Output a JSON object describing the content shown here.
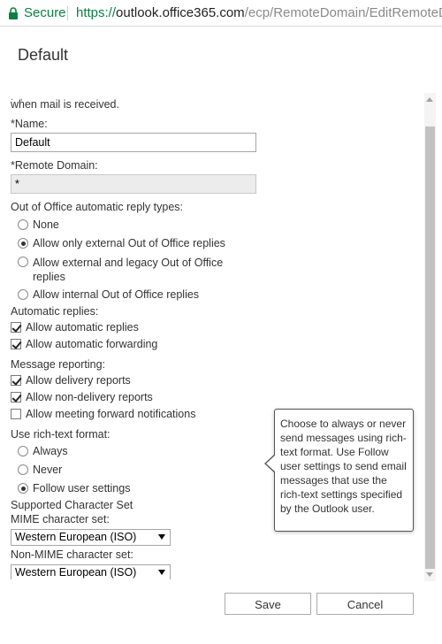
{
  "browser": {
    "secure_label": "Secure",
    "url_protocol": "https://",
    "url_host": "outlook.office365.com",
    "url_path": "/ecp/RemoteDomain/EditRemoteD..."
  },
  "dialog": {
    "title": "Default"
  },
  "form": {
    "clipped_text": "when mail is received.",
    "name_label": "*Name:",
    "name_value": "Default",
    "remote_domain_label": "*Remote Domain:",
    "remote_domain_value": "*",
    "ooo_label": "Out of Office automatic reply types:",
    "ooo_options": [
      {
        "label": "None",
        "selected": false
      },
      {
        "label": "Allow only external Out of Office replies",
        "selected": true
      },
      {
        "label": "Allow external and legacy Out of Office replies",
        "selected": false
      },
      {
        "label": "Allow internal Out of Office replies",
        "selected": false
      }
    ],
    "auto_label": "Automatic replies:",
    "auto_options": [
      {
        "label": "Allow automatic replies",
        "checked": true
      },
      {
        "label": "Allow automatic forwarding",
        "checked": true
      }
    ],
    "report_label": "Message reporting:",
    "report_options": [
      {
        "label": "Allow delivery reports",
        "checked": true
      },
      {
        "label": "Allow non-delivery reports",
        "checked": true
      },
      {
        "label": "Allow meeting forward notifications",
        "checked": false
      }
    ],
    "richtext_label": "Use rich-text format:",
    "richtext_options": [
      {
        "label": "Always",
        "selected": false
      },
      {
        "label": "Never",
        "selected": false
      },
      {
        "label": "Follow user settings",
        "selected": true
      }
    ],
    "charset_label": "Supported Character Set",
    "mime_label": "MIME character set:",
    "mime_value": "Western European (ISO)",
    "nonmime_label": "Non-MIME character set:",
    "nonmime_value": "Western European (ISO)"
  },
  "tooltip": {
    "text": "Choose to always or never send messages using rich-text format. Use Follow user settings to send email messages that use the rich-text settings specified by the Outlook user."
  },
  "buttons": {
    "save": "Save",
    "cancel": "Cancel"
  },
  "colors": {
    "secure_green": "#0b8043",
    "text": "#333333"
  }
}
